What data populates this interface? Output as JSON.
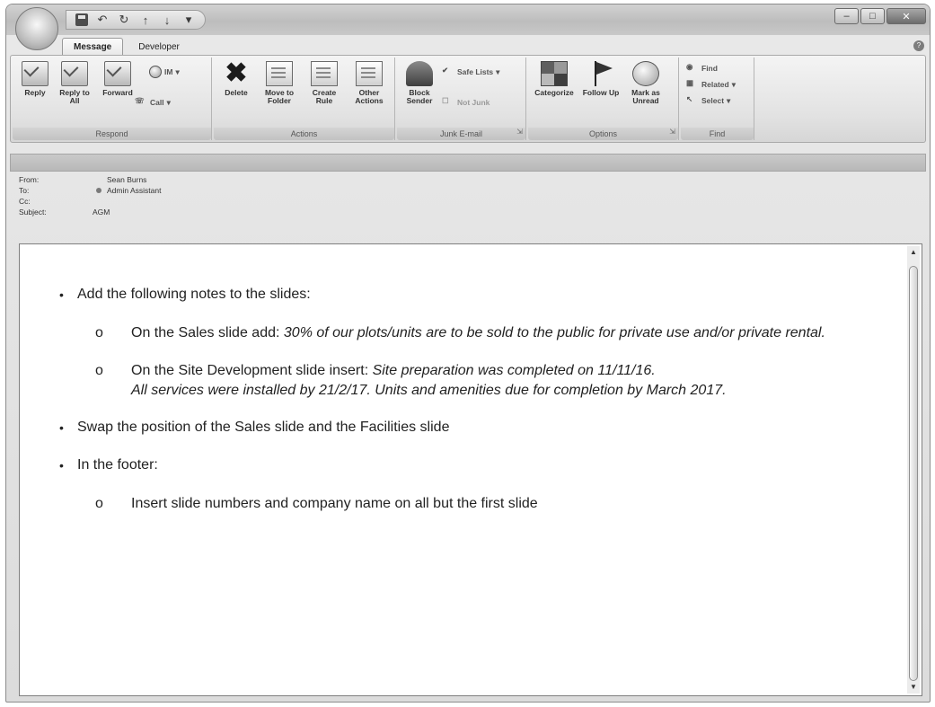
{
  "window": {
    "qat": [
      "save-icon",
      "undo-icon",
      "redo-icon",
      "up-arrow-icon",
      "down-arrow-icon",
      "customize-icon"
    ],
    "qat_glyphs": [
      "",
      "↶",
      "↻",
      "↑",
      "↓",
      "▾"
    ]
  },
  "tabs": [
    "Message",
    "Developer"
  ],
  "ribbon": {
    "respond": {
      "label": "Respond",
      "reply": "Reply",
      "reply_all": "Reply to All",
      "forward": "Forward",
      "im": "IM",
      "call": "Call"
    },
    "actions": {
      "label": "Actions",
      "delete": "Delete",
      "move_to_folder": "Move to Folder",
      "create_rule": "Create Rule",
      "other_actions": "Other Actions"
    },
    "junk": {
      "label": "Junk E-mail",
      "block_sender": "Block Sender",
      "safe_lists": "Safe Lists",
      "not_junk": "Not Junk"
    },
    "options": {
      "label": "Options",
      "categorize": "Categorize",
      "follow_up": "Follow Up",
      "mark_as_unread": "Mark as Unread"
    },
    "find": {
      "label": "Find",
      "find": "Find",
      "related": "Related",
      "select": "Select"
    }
  },
  "header": {
    "from_label": "From:",
    "from_value": "Sean Burns",
    "to_label": "To:",
    "to_value": "Admin Assistant",
    "cc_label": "Cc:",
    "cc_value": "",
    "subject_label": "Subject:",
    "subject_value": "AGM"
  },
  "body": {
    "bullet1": "Add the following notes to the slides:",
    "sub_marker": "o",
    "sub1_prefix": "On the Sales slide add: ",
    "sub1_italic": "30% of our plots/units are to be sold to the public for private use and/or private rental.",
    "sub2_prefix": "On the Site Development slide insert: ",
    "sub2_italic_line1": "Site preparation was completed on 11/11/16.",
    "sub2_italic_line2": "All services were installed by 21/2/17. Units and amenities due for completion by March 2017.",
    "bullet2": "Swap the position of the Sales slide and the Facilities slide",
    "bullet3": "In the footer:",
    "sub3": "Insert slide numbers and company name on all but the first slide"
  }
}
